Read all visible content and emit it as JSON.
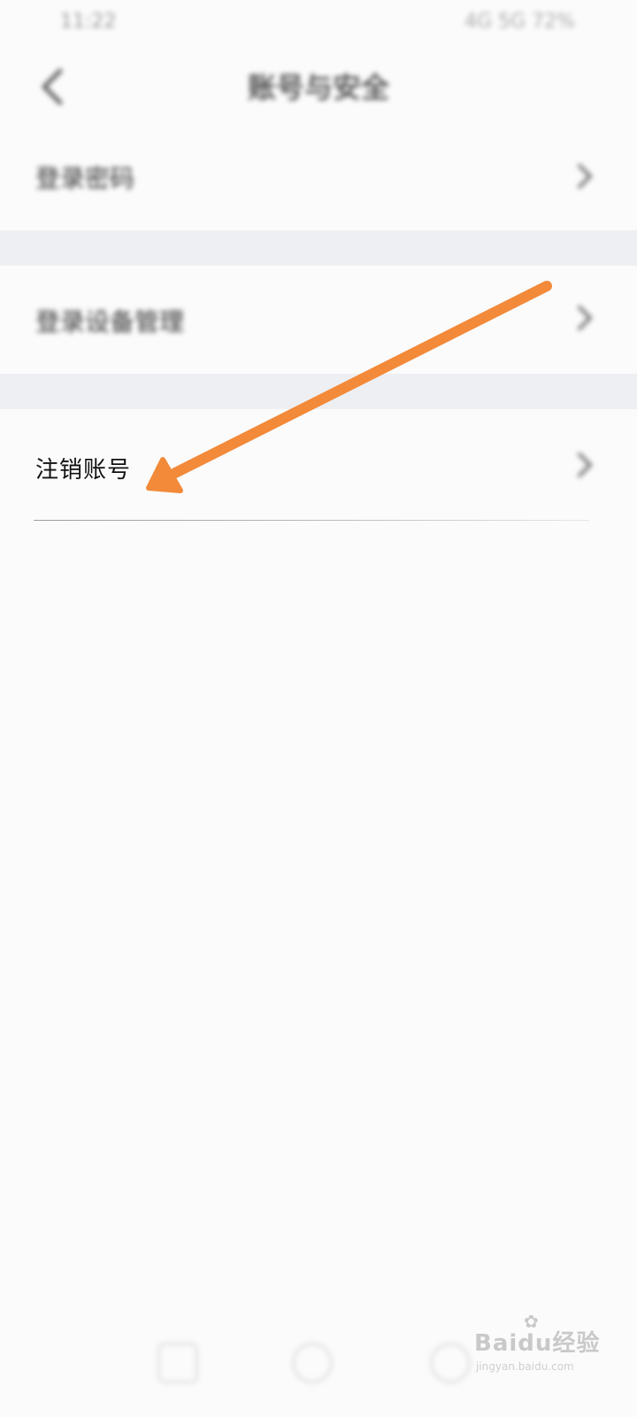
{
  "status_bar": {
    "time": "11:22",
    "right_text": "4G 5G 72%"
  },
  "header": {
    "title": "账号与安全",
    "back_icon": "back-chevron-icon"
  },
  "menu_sections": [
    {
      "label": "登录密码",
      "icon": "chevron-right-icon",
      "blurred": true
    },
    {
      "label": "登录设备管理",
      "icon": "chevron-right-icon",
      "blurred": true
    },
    {
      "label": "注销账号",
      "icon": "chevron-right-icon",
      "blurred": false
    }
  ],
  "annotation": {
    "icon": "orange-arrow-icon",
    "color": "#f28a3a",
    "points_to": "注销账号"
  },
  "bottom_nav": {
    "icons": [
      "square-nav-icon",
      "circle-nav-icon",
      "back-nav-icon"
    ]
  },
  "watermark": {
    "brand": "Baidu经验",
    "url": "jingyan.baidu.com",
    "icon": "paw-icon"
  },
  "colors": {
    "background": "#fbfbfc",
    "section_gap": "#eeeff2",
    "arrow": "#f28a3a"
  }
}
